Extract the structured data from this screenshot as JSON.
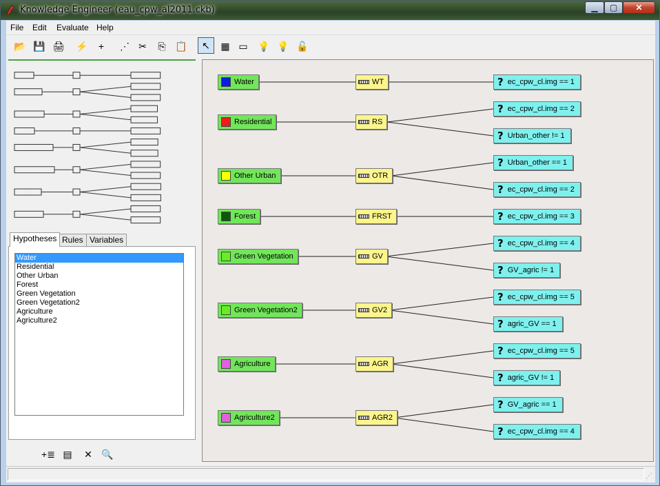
{
  "window": {
    "title": "Knowledge Engineer (eau_cpw_al2011.ckb)"
  },
  "menu": [
    "File",
    "Edit",
    "Evaluate",
    "Help"
  ],
  "toolbar": [
    {
      "name": "open-icon",
      "glyph": "📂"
    },
    {
      "name": "save-icon",
      "glyph": "💾"
    },
    {
      "name": "print-icon",
      "glyph": "🖨"
    },
    {
      "name": "run-icon",
      "glyph": "⚡"
    },
    {
      "name": "add-icon",
      "glyph": "+"
    },
    {
      "name": "connect-icon",
      "glyph": "⋰"
    },
    {
      "name": "cut-icon",
      "glyph": "✂"
    },
    {
      "name": "copy-icon",
      "glyph": "⎘"
    },
    {
      "name": "paste-icon",
      "glyph": "📋"
    },
    {
      "name": "select-arrow-icon",
      "glyph": "↖"
    },
    {
      "name": "color-ab-icon",
      "glyph": "▦"
    },
    {
      "name": "ruler-icon",
      "glyph": "▭"
    },
    {
      "name": "bulb-icon",
      "glyph": "💡"
    },
    {
      "name": "bulb-dark-icon",
      "glyph": "💡"
    },
    {
      "name": "lock-icon",
      "glyph": "🔓"
    }
  ],
  "tabs": [
    "Hypotheses",
    "Rules",
    "Variables"
  ],
  "hypothesis_list": [
    "Water",
    "Residential",
    "Other Urban",
    "Forest",
    "Green Vegetation",
    "Green Vegetation2",
    "Agriculture",
    "Agriculture2"
  ],
  "tree": [
    {
      "hypothesis": "Water",
      "color": "#0a1ee0",
      "rule": "WT",
      "conditions": [
        "ec_cpw_cl.img == 1"
      ]
    },
    {
      "hypothesis": "Residential",
      "color": "#ee1c1c",
      "rule": "RS",
      "conditions": [
        "ec_cpw_cl.img == 2",
        "Urban_other != 1"
      ]
    },
    {
      "hypothesis": "Other Urban",
      "color": "#ffff00",
      "rule": "OTR",
      "conditions": [
        "Urban_other == 1",
        "ec_cpw_cl.img == 2"
      ]
    },
    {
      "hypothesis": "Forest",
      "color": "#0a5a0a",
      "rule": "FRST",
      "conditions": [
        "ec_cpw_cl.img == 3"
      ]
    },
    {
      "hypothesis": "Green Vegetation",
      "color": "#66ee22",
      "rule": "GV",
      "conditions": [
        "ec_cpw_cl.img == 4",
        "GV_agric != 1"
      ]
    },
    {
      "hypothesis": "Green Vegetation2",
      "color": "#66ee22",
      "rule": "GV2",
      "conditions": [
        "ec_cpw_cl.img == 5",
        "agric_GV == 1"
      ]
    },
    {
      "hypothesis": "Agriculture",
      "color": "#e060e0",
      "rule": "AGR",
      "conditions": [
        "ec_cpw_cl.img == 5",
        "agric_GV != 1"
      ]
    },
    {
      "hypothesis": "Agriculture2",
      "color": "#e060e0",
      "rule": "AGR2",
      "conditions": [
        "GV_agric == 1",
        "ec_cpw_cl.img == 4"
      ]
    }
  ],
  "bottom_tools": [
    {
      "name": "add-rule-icon",
      "glyph": "+≣"
    },
    {
      "name": "properties-icon",
      "glyph": "▤"
    },
    {
      "name": "delete-icon",
      "glyph": "✕"
    },
    {
      "name": "find-icon",
      "glyph": "🔍"
    }
  ]
}
